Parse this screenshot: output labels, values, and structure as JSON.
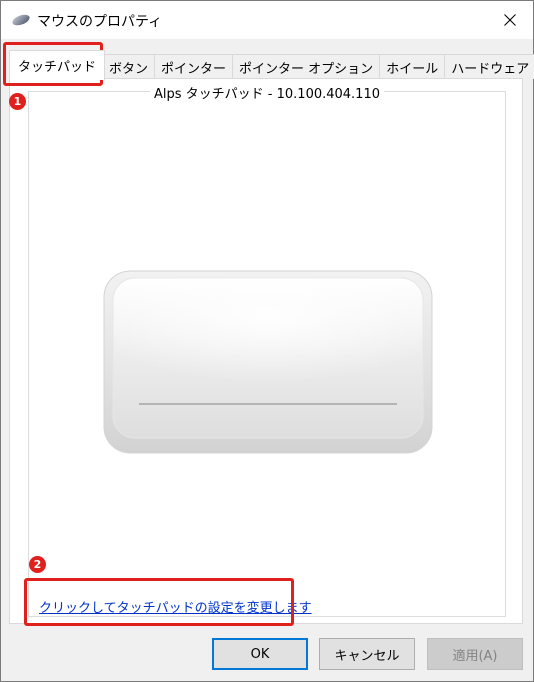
{
  "window": {
    "title": "マウスのプロパティ",
    "icon": "mouse-icon"
  },
  "tabs": [
    {
      "label": "タッチパッド",
      "active": true
    },
    {
      "label": "ボタン",
      "active": false
    },
    {
      "label": "ポインター",
      "active": false
    },
    {
      "label": "ポインター オプション",
      "active": false
    },
    {
      "label": "ホイール",
      "active": false
    },
    {
      "label": "ハードウェア",
      "active": false
    }
  ],
  "panel": {
    "device_label": "Alps タッチパッド - 10.100.404.110",
    "settings_link": "クリックしてタッチパッドの設定を変更します"
  },
  "annotations": {
    "badge1": "1",
    "badge2": "2",
    "color": "#e0201d"
  },
  "buttons": {
    "ok": "OK",
    "cancel": "キャンセル",
    "apply": "適用(A)"
  }
}
